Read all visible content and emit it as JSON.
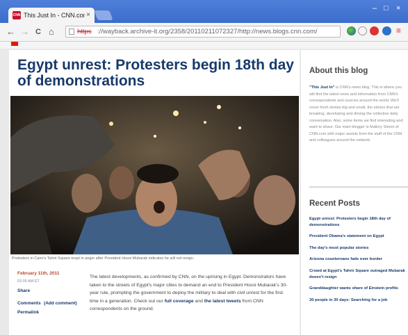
{
  "browser": {
    "tab_title": "This Just In - CNN.com Bl",
    "tab_close": "×",
    "win_minimize": "–",
    "win_restore": "□",
    "win_close": "×",
    "back": "←",
    "forward": "→",
    "reload": "C",
    "home": "⌂",
    "url_scheme": "https",
    "url_rest": "://wayback.archive-it.org/2358/20110211072327/http://news.blogs.cnn.com/",
    "favicon_text": "CNN",
    "colors": {
      "chrome_blue": "#3b6dcc",
      "cnn_red": "#c8102e"
    }
  },
  "article": {
    "headline": "Egypt unrest: Protesters begin 18th day of demonstrations",
    "caption": "Protesters in Cairo's Tahrir Square erupt in anger after President Hosni Mubarak indicates he will not resign.",
    "date": "February 11th, 2011",
    "time": "02:09 AM ET",
    "share": "Share",
    "comments": "Comments",
    "add_comment": "(Add comment)",
    "permalink": "Permalink",
    "body_1": "The latest developments, as confirmed by CNN, on the uprising in Egypt. Demonstrators have taken to the streets of Egypt's major cities to demand an end to President Hosni Mubarak's 30-year rule, prompting the government to deploy the military to deal with civil unrest for the first time in a generation. Check out our ",
    "link_coverage": "full coverage",
    "body_2": " and ",
    "link_tweets": "the latest tweets",
    "body_3": " from CNN correspondents on the ground."
  },
  "sidebar": {
    "about_title": "About this blog",
    "about_lead": "\"This Just In\"",
    "about_text": " is CNN's news blog. This is where you will find the latest news and information from CNN's correspondents and sources around the world. We'll cover fresh stories big and small, the stories that are breaking, developing and driving the collective daily conversation. Also, some items we find interesting and want to share. Our main blogger is Mallory Simon of CNN.com with major assists from the staff of the CNN and colleagues around the network.",
    "recent_title": "Recent Posts",
    "posts": [
      "Egypt unrest: Protesters begin 18th day of demonstrations",
      "President Obama's statement on Egypt",
      "The day's most popular stories",
      "Arizona counteroans fade over border",
      "Crowd at Egypt's Tahrir Square outraged Mubarak doesn't resign",
      "Granddaughter wants share of Einstein profits",
      "30 people in 30 days: Searching for a job"
    ]
  }
}
